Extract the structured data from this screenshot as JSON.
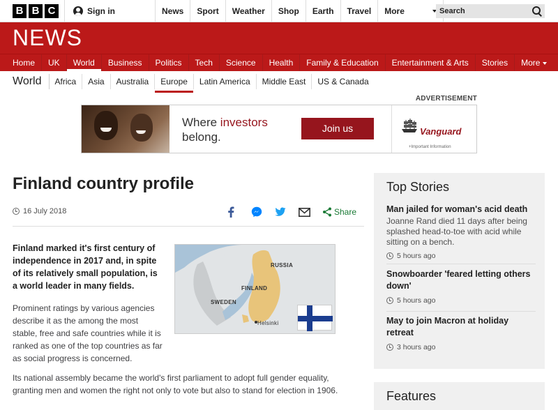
{
  "masthead": {
    "logo_letters": [
      "B",
      "B",
      "C"
    ],
    "signin_label": "Sign in",
    "nav": [
      "News",
      "Sport",
      "Weather",
      "Shop",
      "Earth",
      "Travel"
    ],
    "more_label": "More",
    "search_placeholder": "Search"
  },
  "newsbar": {
    "title": "NEWS",
    "items": [
      "Home",
      "UK",
      "World",
      "Business",
      "Politics",
      "Tech",
      "Science",
      "Health",
      "Family & Education",
      "Entertainment & Arts",
      "Stories"
    ],
    "active_index": 2,
    "more_label": "More"
  },
  "subnav": {
    "section_title": "World",
    "items": [
      "Africa",
      "Asia",
      "Australia",
      "Europe",
      "Latin America",
      "Middle East",
      "US & Canada"
    ],
    "active_index": 3
  },
  "advert": {
    "label": "ADVERTISEMENT",
    "headline_pre": "Where ",
    "headline_accent": "investors",
    "headline_post": "belong.",
    "cta": "Join us",
    "brand": "Vanguard",
    "fineprint": "+Important Information",
    "accent_color": "#96151d"
  },
  "article": {
    "headline": "Finland country profile",
    "date": "16 July 2018",
    "share_label": "Share",
    "share_icons": [
      "facebook-icon",
      "messenger-icon",
      "twitter-icon",
      "email-icon",
      "share-icon"
    ],
    "lead": "Finland marked it's first century of independence in 2017 and, in spite of its relatively small population, is a world leader in many fields.",
    "para1": "Prominent ratings by various agencies describe it as the among the most stable, free and safe countries while it is ranked as one of the top countries as far as social progress is concerned.",
    "para2": "Its national assembly became the world's first parliament to adopt full gender equality, granting men and women the right not only to vote but also to stand for election in 1906.",
    "map_labels": {
      "russia": "RUSSIA",
      "finland": "FINLAND",
      "sweden": "SWEDEN",
      "helsinki": "Helsinki"
    }
  },
  "top_stories": {
    "title": "Top Stories",
    "stories": [
      {
        "headline": "Man jailed for woman's acid death",
        "summary": "Joanne Rand died 11 days after being splashed head-to-toe with acid while sitting on a bench.",
        "time": "5 hours ago"
      },
      {
        "headline": "Snowboarder 'feared letting others down'",
        "summary": "",
        "time": "5 hours ago"
      },
      {
        "headline": "May to join Macron at holiday retreat",
        "summary": "",
        "time": "3 hours ago"
      }
    ]
  },
  "features": {
    "title": "Features"
  },
  "colors": {
    "news_red": "#bb1919",
    "share_green": "#1a7a35",
    "facebook_blue": "#3b5998",
    "messenger_blue": "#0084ff",
    "twitter_blue": "#1da1f2",
    "finland_blue": "#1b3d8f"
  }
}
